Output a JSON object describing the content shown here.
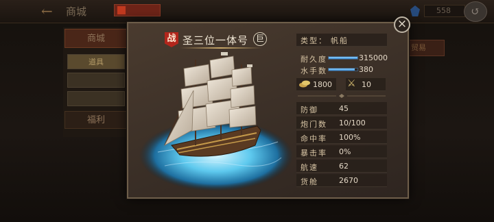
{
  "background": {
    "title": "商城",
    "gem_count": "558",
    "left_panel": {
      "header": "商城",
      "items": [
        "道具",
        "",
        ""
      ],
      "footer": "福利"
    },
    "right_peek": "贸易"
  },
  "modal": {
    "battle_badge": "战",
    "ship_name": "圣三位一体号",
    "size_badge": "巨",
    "type_label": "类型：",
    "type_value": "帆船",
    "durability_label": "耐久度",
    "durability_value": "315000",
    "durability_fraction": 1.0,
    "sailors_label": "水手数",
    "sailors_value": "380",
    "sailors_fraction": 0.9,
    "cost_value": "1800",
    "crossed_swords_value": "10",
    "stats": [
      {
        "label": "防御",
        "value": "45"
      },
      {
        "label": "炮门数",
        "value": "10/100"
      },
      {
        "label": "命中率",
        "value": "100%"
      },
      {
        "label": "暴击率",
        "value": "0%"
      },
      {
        "label": "航速",
        "value": "62"
      },
      {
        "label": "货舱",
        "value": "2670"
      }
    ]
  },
  "colors": {
    "accent_blue": "#4aa3e8",
    "badge_red": "#b2261c",
    "gold": "#d9c072"
  },
  "icons": [
    "back-arrow-icon",
    "gem-icon",
    "return-icon",
    "close-icon",
    "battle-badge-icon",
    "gold-coins-icon",
    "crossed-swords-icon"
  ]
}
